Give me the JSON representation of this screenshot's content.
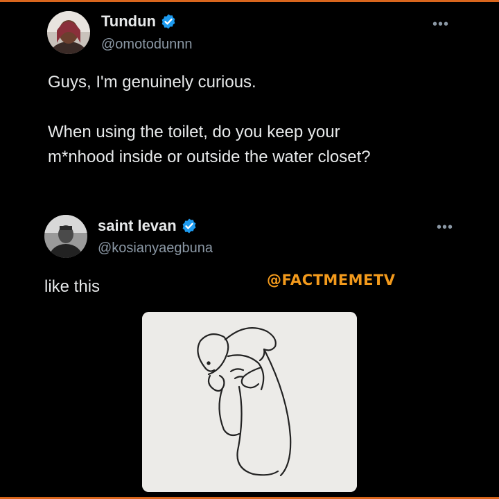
{
  "tweet1": {
    "display_name": "Tundun",
    "handle": "@omotodunnn",
    "text": "Guys, I'm genuinely curious.\n\nWhen using the toilet, do you keep your\nm*nhood inside or outside the water closet?",
    "verified": true
  },
  "tweet2": {
    "display_name": "saint levan",
    "handle": "@kosianyaegbuna",
    "text": "like this",
    "verified": true
  },
  "more_label": "•••",
  "watermark": "@FACTMEMETV",
  "colors": {
    "background": "#000000",
    "verified": "#1d9bf0",
    "watermark": "#f39a1c",
    "frame": "#d9661d"
  },
  "icons": [
    "verified-badge-icon",
    "more-options-icon"
  ]
}
